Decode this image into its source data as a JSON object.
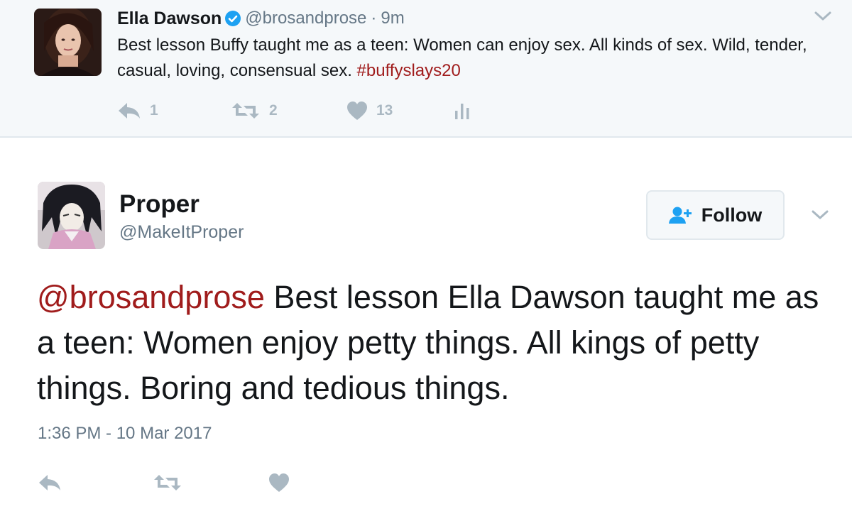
{
  "parent_tweet": {
    "name": "Ella Dawson",
    "verified": true,
    "handle": "@brosandprose",
    "separator": "·",
    "time": "9m",
    "text_main": "Best lesson Buffy taught me as a teen: Women can enjoy sex. All kinds of sex. Wild, tender, casual, loving, consensual sex. ",
    "hashtag": "#buffyslays20",
    "replies": "1",
    "retweets": "2",
    "likes": "13",
    "icons": [
      "reply-icon",
      "retweet-icon",
      "like-icon",
      "analytics-icon",
      "chevron-down-icon",
      "verified-badge-icon"
    ]
  },
  "main_tweet": {
    "name": "Proper",
    "handle": "@MakeItProper",
    "follow_label": "Follow",
    "mention": "@brosandprose",
    "text_main": " Best lesson Ella Dawson taught me as a teen: Women enjoy petty things. All kings of petty things. Boring and tedious things.",
    "timestamp": "1:36 PM - 10 Mar 2017",
    "icons": [
      "follow-person-icon",
      "chevron-down-icon",
      "reply-icon",
      "retweet-icon",
      "like-icon"
    ]
  },
  "colors": {
    "accent_link": "#a01c1c",
    "secondary_text": "#657786",
    "icon_grey": "#aab8c2",
    "follow_icon": "#1da1f2",
    "verified": "#1da1f2",
    "parent_bg": "#f5f8fa"
  }
}
